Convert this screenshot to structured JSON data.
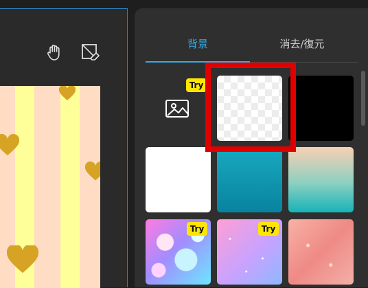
{
  "toolbar": {
    "hand_tool_icon": "hand-icon",
    "eraser_tool_icon": "eraser-icon"
  },
  "panel": {
    "tabs": [
      {
        "label": "背景",
        "active": true
      },
      {
        "label": "消去/復元",
        "active": false
      }
    ],
    "tiles": [
      {
        "kind": "upload-image",
        "icon": "image-icon",
        "badge": "Try"
      },
      {
        "kind": "transparent",
        "badge": ""
      },
      {
        "kind": "black",
        "color": "#000000",
        "badge": ""
      },
      {
        "kind": "white",
        "color": "#ffffff",
        "badge": ""
      },
      {
        "kind": "teal-gradient",
        "badge": ""
      },
      {
        "kind": "peach-teal-gradient",
        "badge": ""
      },
      {
        "kind": "bubbles",
        "badge": "Try"
      },
      {
        "kind": "glitter",
        "badge": "Try"
      },
      {
        "kind": "coral",
        "badge": ""
      }
    ],
    "selected_tile_index": 1
  },
  "colors": {
    "accent": "#36a9e6",
    "badge": "#ffe600",
    "highlight": "#e00000"
  }
}
